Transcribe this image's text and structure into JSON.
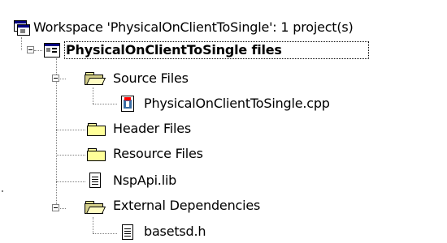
{
  "workspace": {
    "label": "Workspace 'PhysicalOnClientToSingle': 1 project(s)",
    "icon": "workspace-icon"
  },
  "project": {
    "label": "PhysicalOnClientToSingle files",
    "icon": "project-icon",
    "expanded": true
  },
  "items": [
    {
      "label": "Source Files",
      "icon": "open-folder-icon",
      "expanded": true
    },
    {
      "label": "PhysicalOnClientToSingle.cpp",
      "icon": "cpp-file-icon"
    },
    {
      "label": "Header Files",
      "icon": "folder-icon"
    },
    {
      "label": "Resource Files",
      "icon": "folder-icon"
    },
    {
      "label": "NspApi.lib",
      "icon": "document-icon"
    },
    {
      "label": "External Dependencies",
      "icon": "open-folder-icon",
      "expanded": true
    },
    {
      "label": "basetsd.h",
      "icon": "document-icon"
    }
  ]
}
